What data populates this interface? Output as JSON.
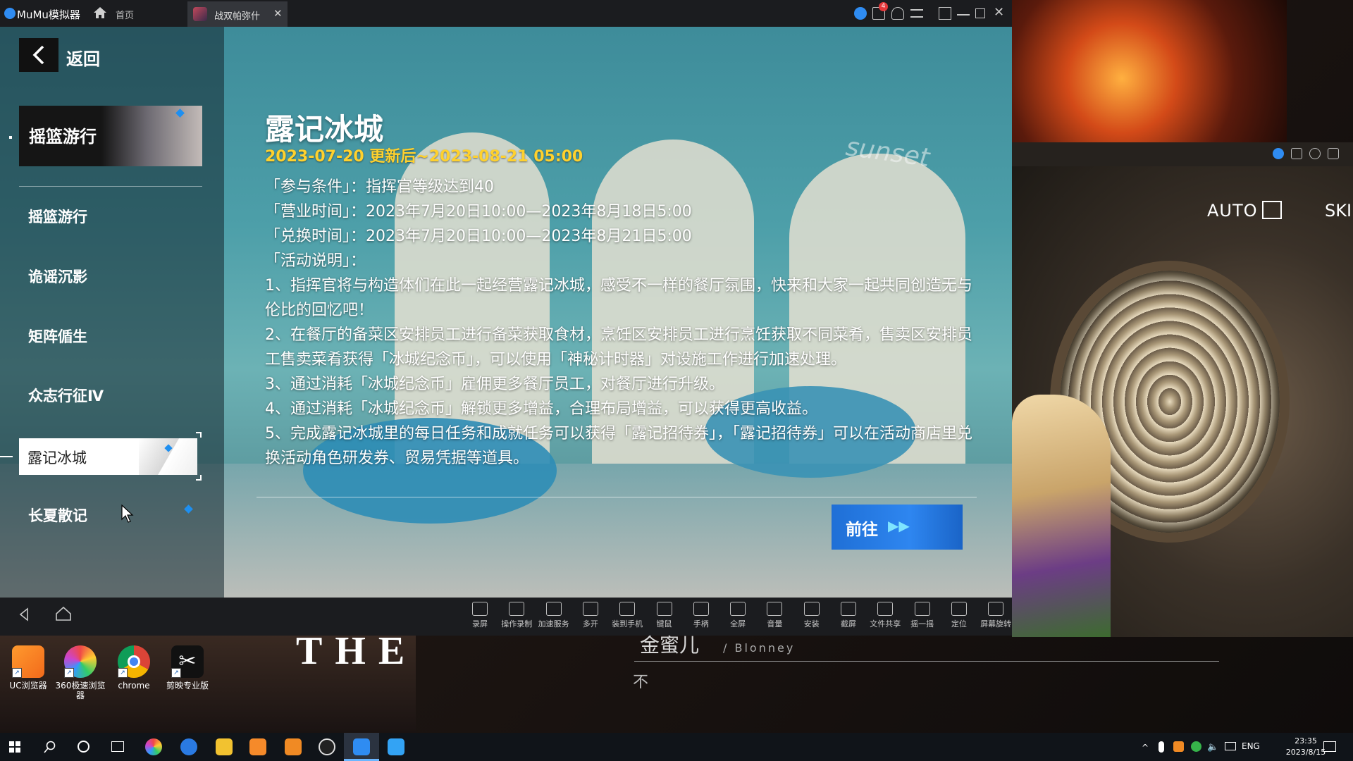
{
  "emulator": {
    "app_name": "MuMu模拟器",
    "home_tab": "首页",
    "game_tab": "战双帕弥什",
    "game_tab_close": "✕",
    "notification_count": "4"
  },
  "sidebar": {
    "back_label": "返回",
    "banner_title": "摇篮游行",
    "items": [
      {
        "label": "摇篮游行"
      },
      {
        "label": "诡谣沉影"
      },
      {
        "label": "矩阵偱生"
      },
      {
        "label": "众志行征Ⅳ"
      },
      {
        "label": "露记冰城",
        "active": true
      },
      {
        "label": "长夏散记"
      }
    ]
  },
  "content": {
    "title": "露记冰城",
    "date_range": "2023-07-20 更新后~2023-08-21 05:00",
    "lines": [
      "「参与条件」：指挥官等级达到40",
      "「营业时间」：2023年7月20日10:00—2023年8月18日5:00",
      "「兑换时间」：2023年7月20日10:00—2023年8月21日5:00",
      "「活动说明」：",
      "1、指挥官将与构造体们在此一起经营露记冰城，感受不一样的餐厅氛围，快来和大家一起共同创造无与伦比的回忆吧！",
      "2、在餐厅的备菜区安排员工进行备菜获取食材，烹饪区安排员工进行烹饪获取不同菜肴，售卖区安排员工售卖菜肴获得「冰城纪念币」，可以使用「神秘计时器」对设施工作进行加速处理。",
      "3、通过消耗「冰城纪念币」雇佣更多餐厅员工，对餐厅进行升级。",
      "4、通过消耗「冰城纪念币」解锁更多增益，合理布局增益，可以获得更高收益。",
      "5、完成露记冰城里的每日任务和成就任务可以获得「露记招待券」，「露记招待券」可以在活动商店里兑换活动角色研发券、贸易凭据等道具。"
    ],
    "goto_label": "前往",
    "goto_arrows": "▶▶",
    "scene_sign": "sunset"
  },
  "toolbar": [
    {
      "label": "录屏",
      "icon": "record-icon"
    },
    {
      "label": "操作录制",
      "icon": "macro-icon"
    },
    {
      "label": "加速服务",
      "icon": "boost-icon"
    },
    {
      "label": "多开",
      "icon": "multi-instance-icon"
    },
    {
      "label": "装到手机",
      "icon": "install-phone-icon"
    },
    {
      "label": "键鼠",
      "icon": "keyboard-icon"
    },
    {
      "label": "手柄",
      "icon": "gamepad-icon"
    },
    {
      "label": "全屏",
      "icon": "fullscreen-icon"
    },
    {
      "label": "音量",
      "icon": "volume-icon"
    },
    {
      "label": "安装",
      "icon": "apk-icon"
    },
    {
      "label": "截屏",
      "icon": "screenshot-icon"
    },
    {
      "label": "文件共享",
      "icon": "folder-icon"
    },
    {
      "label": "摇一摇",
      "icon": "shake-icon"
    },
    {
      "label": "定位",
      "icon": "location-icon"
    },
    {
      "label": "屏幕旋转",
      "icon": "rotate-icon"
    }
  ],
  "desktop": {
    "icons": [
      {
        "label": "UC浏览器"
      },
      {
        "label": "360极速浏览器"
      },
      {
        "label": "chrome"
      },
      {
        "label": "剪映专业版"
      }
    ],
    "banner_text": "THE",
    "lower_name": "金蜜儿",
    "lower_name_en": "/ Blonney",
    "lower_char": "不"
  },
  "game2": {
    "auto_label": "AUTO",
    "skip_label": "SKI"
  },
  "taskbar": {
    "lang": "ENG",
    "time": "23:35",
    "date": "2023/8/15"
  }
}
